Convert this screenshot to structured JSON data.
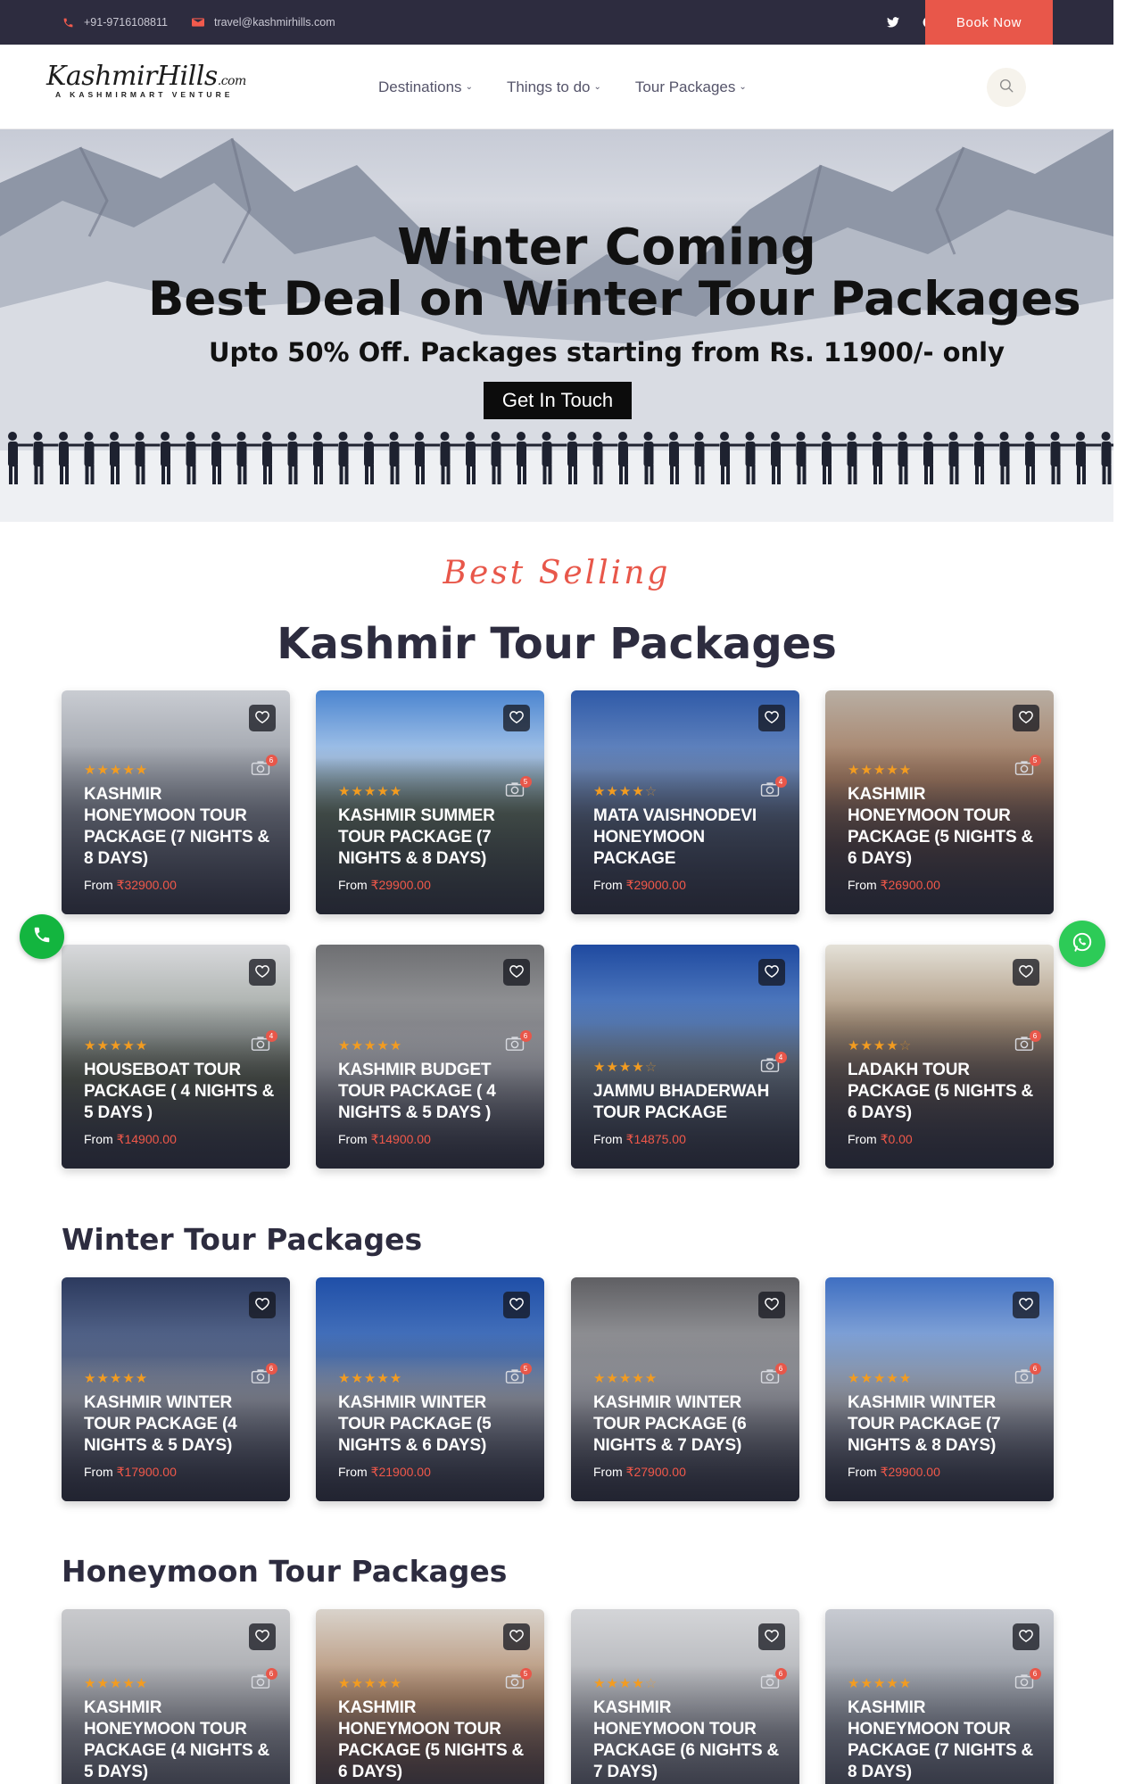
{
  "topbar": {
    "phone": "+91-9716108811",
    "email": "travel@kashmirhills.com",
    "social_icons": [
      "twitter-icon",
      "facebook-icon",
      "instagram-icon"
    ],
    "book_now": "Book Now",
    "accent": "#e8574a",
    "background": "#2d2c3f"
  },
  "header": {
    "logo_main": "KashmirHills",
    "logo_suffix": ".com",
    "logo_tagline": "A KASHMIRMART VENTURE",
    "nav": [
      {
        "label": "Destinations"
      },
      {
        "label": "Things to do"
      },
      {
        "label": "Tour Packages"
      }
    ]
  },
  "hero": {
    "line1": "Winter Coming",
    "line2": "Best Deal on Winter Tour Packages",
    "line3": "Upto 50% Off. Packages starting from Rs. 11900/- only",
    "cta": "Get In Touch"
  },
  "section_best": {
    "script": "Best Selling",
    "title": "Kashmir Tour Packages",
    "cards": [
      {
        "name": "KASHMIR HONEYMOON TOUR PACKAGE (7 NIGHTS & 8 DAYS)",
        "price_prefix": "From ",
        "price": "₹32900.00",
        "rating": 5,
        "photos": "6"
      },
      {
        "name": "KASHMIR SUMMER TOUR PACKAGE (7 NIGHTS & 8 DAYS)",
        "price_prefix": "From ",
        "price": "₹29900.00",
        "rating": 5,
        "photos": "5"
      },
      {
        "name": "MATA VAISHNODEVI HONEYMOON PACKAGE",
        "price_prefix": "From ",
        "price": "₹29000.00",
        "rating": 4,
        "photos": "4"
      },
      {
        "name": "KASHMIR HONEYMOON TOUR PACKAGE (5 NIGHTS & 6 DAYS)",
        "price_prefix": "From ",
        "price": "₹26900.00",
        "rating": 5,
        "photos": "5"
      },
      {
        "name": "HOUSEBOAT TOUR PACKAGE ( 4 NIGHTS & 5 DAYS )",
        "price_prefix": "From ",
        "price": "₹14900.00",
        "rating": 5,
        "photos": "4"
      },
      {
        "name": "KASHMIR BUDGET TOUR PACKAGE ( 4 NIGHTS & 5 DAYS )",
        "price_prefix": "From ",
        "price": "₹14900.00",
        "rating": 5,
        "photos": "6"
      },
      {
        "name": "JAMMU BHADERWAH TOUR PACKAGE",
        "price_prefix": "From ",
        "price": "₹14875.00",
        "rating": 4,
        "photos": "4"
      },
      {
        "name": "LADAKH TOUR PACKAGE (5 NIGHTS & 6 DAYS)",
        "price_prefix": "From ",
        "price": "₹0.00",
        "rating": 4,
        "photos": "6"
      }
    ]
  },
  "section_winter": {
    "title": "Winter Tour Packages",
    "cards": [
      {
        "name": "KASHMIR WINTER TOUR PACKAGE (4 NIGHTS & 5 DAYS)",
        "price_prefix": "From ",
        "price": "₹17900.00",
        "rating": 5,
        "photos": "6"
      },
      {
        "name": "KASHMIR WINTER TOUR PACKAGE (5 NIGHTS & 6 DAYS)",
        "price_prefix": "From ",
        "price": "₹21900.00",
        "rating": 5,
        "photos": "5"
      },
      {
        "name": "KASHMIR WINTER TOUR PACKAGE (6 NIGHTS & 7 DAYS)",
        "price_prefix": "From ",
        "price": "₹27900.00",
        "rating": 5,
        "photos": "6"
      },
      {
        "name": "KASHMIR WINTER TOUR PACKAGE (7 NIGHTS & 8 DAYS)",
        "price_prefix": "From ",
        "price": "₹29900.00",
        "rating": 5,
        "photos": "6"
      }
    ]
  },
  "section_honeymoon": {
    "title": "Honeymoon Tour Packages",
    "cards": [
      {
        "name": "KASHMIR HONEYMOON TOUR PACKAGE (4 NIGHTS & 5 DAYS)",
        "rating": 5,
        "photos": "6"
      },
      {
        "name": "KASHMIR HONEYMOON TOUR PACKAGE (5 NIGHTS & 6 DAYS)",
        "rating": 5,
        "photos": "5"
      },
      {
        "name": "KASHMIR HONEYMOON TOUR PACKAGE (6 NIGHTS & 7 DAYS)",
        "rating": 4,
        "photos": "6"
      },
      {
        "name": "KASHMIR HONEYMOON TOUR PACKAGE (7 NIGHTS & 8 DAYS)",
        "rating": 5,
        "photos": "6"
      }
    ]
  },
  "floating": {
    "call_icon": "phone-icon",
    "whatsapp_icon": "whatsapp-icon"
  }
}
